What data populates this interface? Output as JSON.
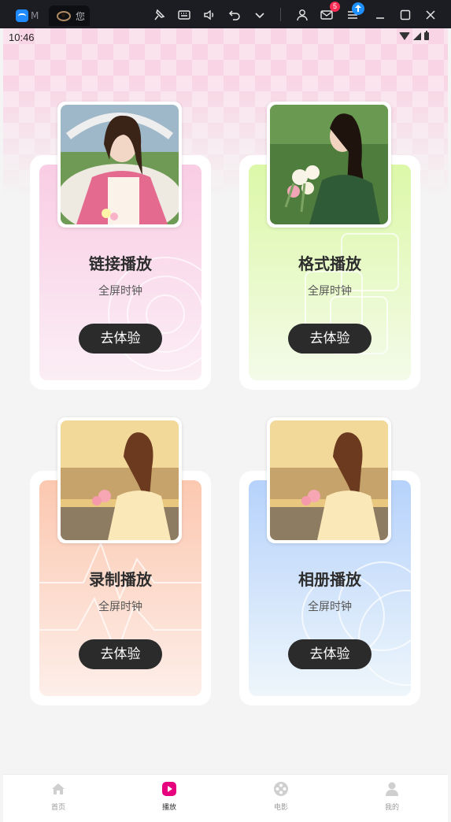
{
  "window": {
    "tab1_label": "M",
    "tab2_label": "您",
    "notification_count": "5"
  },
  "status_bar": {
    "time": "10:46"
  },
  "cards": [
    {
      "title": "链接播放",
      "subtitle": "全屏时钟",
      "button": "去体验",
      "theme": "pink",
      "accent": "#f9cde4"
    },
    {
      "title": "格式播放",
      "subtitle": "全屏时钟",
      "button": "去体验",
      "theme": "green",
      "accent": "#dcf8a8"
    },
    {
      "title": "录制播放",
      "subtitle": "全屏时钟",
      "button": "去体验",
      "theme": "peach",
      "accent": "#fcc8b0"
    },
    {
      "title": "相册播放",
      "subtitle": "全屏时钟",
      "button": "去体验",
      "theme": "blue",
      "accent": "#b6d2fb"
    }
  ],
  "bottom_nav": {
    "items": [
      {
        "label": "首页",
        "icon": "home-icon",
        "active": false
      },
      {
        "label": "播放",
        "icon": "play-icon",
        "active": true
      },
      {
        "label": "电影",
        "icon": "film-reel-icon",
        "active": false
      },
      {
        "label": "我的",
        "icon": "profile-icon",
        "active": false
      }
    ],
    "active_color": "#e6007e"
  }
}
